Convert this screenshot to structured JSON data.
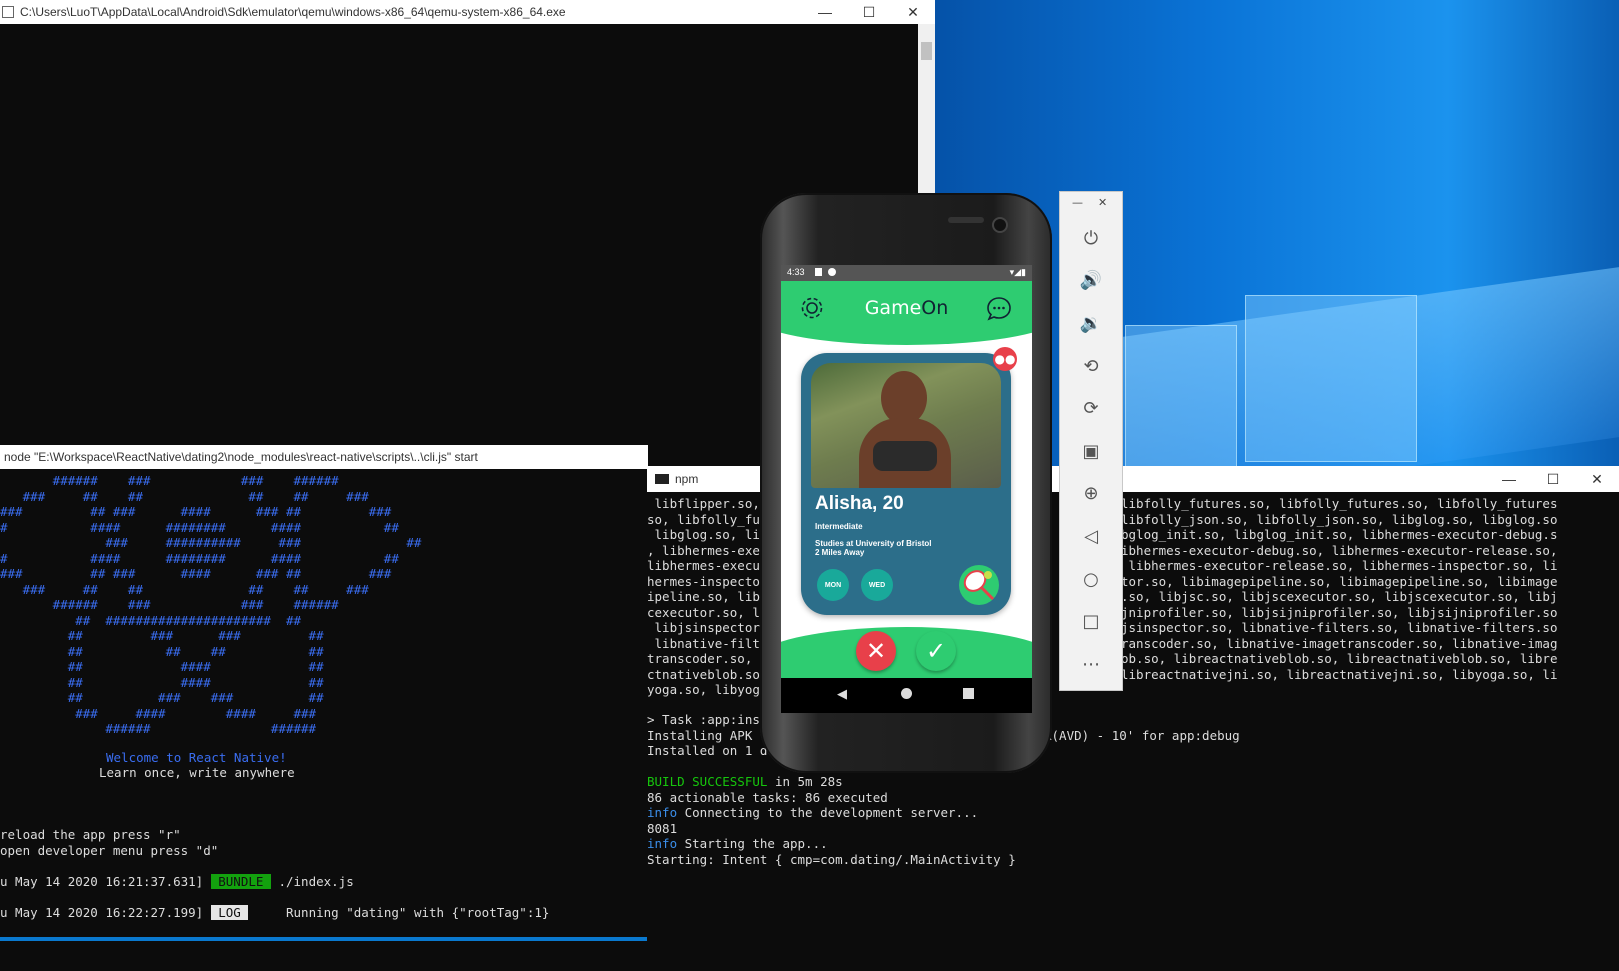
{
  "qemu_window": {
    "title": "C:\\Users\\LuoT\\AppData\\Local\\Android\\Sdk\\emulator\\qemu\\windows-x86_64\\qemu-system-x86_64.exe",
    "minimize": "—",
    "maximize": "☐",
    "close": "✕"
  },
  "node_window": {
    "title": "node  \"E:\\Workspace\\ReactNative\\dating2\\node_modules\\react-native\\scripts\\..\\cli.js\" start",
    "ascii_art": [
      "       ######    ###            ###    ######",
      "   ###     ##    ##              ##    ##     ###",
      "###         ## ###      ####      ### ##         ###",
      "#           ####      ########      ####           ##",
      "              ###     ##########     ###              ##",
      "#           ####      ########      ####           ##",
      "###         ## ###      ####      ### ##         ###",
      "   ###     ##    ##              ##    ##     ###",
      "       ######    ###            ###    ######",
      "          ##  ######################  ##",
      "         ##         ###      ###         ##",
      "         ##           ##    ##           ##",
      "         ##             ####             ##",
      "         ##             ####             ##",
      "         ##          ###    ###          ##",
      "          ###     ####        ####     ###",
      "              ######                ######"
    ],
    "welcome": "Welcome to React Native!",
    "tagline": "Learn once, write anywhere",
    "reload_hint": "reload the app press \"r\"",
    "devmenu_hint": "open developer menu press \"d\"",
    "log1_time": "u May 14 2020 16:21:37.631]",
    "log1_tag": " BUNDLE ",
    "log1_text": " ./index.js",
    "log2_time": "u May 14 2020 16:22:27.199]",
    "log2_tag": " LOG ",
    "log2_text": "     Running \"dating\" with {\"rootTag\":1}"
  },
  "npm_window": {
    "title": "npm",
    "left_lines": [
      " libflipper.so,",
      "so, libfolly_fu",
      " libglog.so, li",
      ", libhermes-exe",
      "libhermes-execu",
      "hermes-inspecto",
      "ipeline.so, lib",
      "cexecutor.so, l",
      " libjsinspector",
      " libnative-filt",
      "transcoder.so, ",
      "ctnativeblob.so",
      "yoga.so, libyog"
    ],
    "right_lines": [
      "libfolly_futures.so, libfolly_futures.so, libfolly_futures",
      "libfolly_json.so, libfolly_json.so, libglog.so, libglog.so",
      "bglog_init.so, libglog_init.so, libhermes-executor-debug.s",
      "ibhermes-executor-debug.so, libhermes-executor-release.so,",
      " libhermes-executor-release.so, libhermes-inspector.so, li",
      "tor.so, libimagepipeline.so, libimagepipeline.so, libimage",
      ".so, libjsc.so, libjscexecutor.so, libjscexecutor.so, libj",
      "jniprofiler.so, libjsijniprofiler.so, libjsijniprofiler.so",
      "jsinspector.so, libnative-filters.so, libnative-filters.so",
      "ranscoder.so, libnative-imagetranscoder.so, libnative-imag",
      "ob.so, libreactnativeblob.so, libreactnativeblob.so, libre",
      "libreactnativejni.so, libreactnativejni.so, libyoga.so, li"
    ],
    "task_line": "> Task :app:ins",
    "installing": "Installing APK ",
    "installing_rest": "R(AVD) - 10' for app:debug",
    "installed": "Installed on 1 de",
    "build_ok": "BUILD SUCCESSFUL",
    "build_time": " in 5m 28s",
    "tasks": "86 actionable tasks: 86 executed",
    "info1_tag": "info",
    "info1": " Connecting to the development server...",
    "port": "8081",
    "info2_tag": "info",
    "info2": " Starting the app...",
    "starting": "Starting: Intent { cmp=com.dating/.MainActivity }"
  },
  "phone": {
    "status_time": "4:33",
    "app_title_a": "Game",
    "app_title_b": "On",
    "card_name": "Alisha, 20",
    "card_level": "Intermediate",
    "card_study": "Studies at University of Bristol",
    "card_distance": "2 Miles Away",
    "day1": "MON",
    "day2": "WED",
    "colors": {
      "green": "#2ecc71",
      "card": "#2c6e8a",
      "teal": "#19a99a",
      "reject": "#e8404a"
    }
  },
  "emulator_toolbar": {
    "minimize": "—",
    "close": "✕"
  }
}
